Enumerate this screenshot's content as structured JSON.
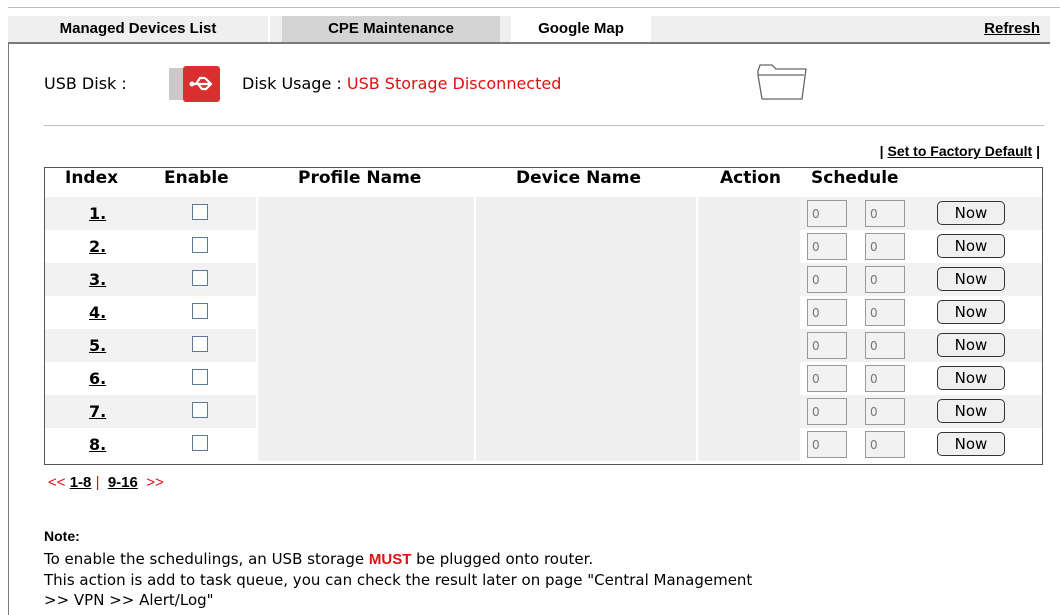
{
  "tabs": [
    {
      "label": "Managed Devices List"
    },
    {
      "label": "CPE Maintenance"
    },
    {
      "label": "Google Map"
    }
  ],
  "refresh_label": "Refresh",
  "usb": {
    "label": "USB Disk :",
    "usage_label": "Disk Usage :",
    "usage_status": "USB Storage Disconnected",
    "icon": "usb-icon",
    "folder_icon": "folder-icon"
  },
  "factory_default": "Set to Factory Default",
  "table": {
    "headers": [
      "Index",
      "Enable",
      "Profile Name",
      "Device Name",
      "Action",
      "Schedule"
    ],
    "rows": [
      {
        "index": "1.",
        "enabled": false,
        "profile": "",
        "device": "",
        "action": "",
        "sched_a": "0",
        "sched_b": "0",
        "button": "Now"
      },
      {
        "index": "2.",
        "enabled": false,
        "profile": "",
        "device": "",
        "action": "",
        "sched_a": "0",
        "sched_b": "0",
        "button": "Now"
      },
      {
        "index": "3.",
        "enabled": false,
        "profile": "",
        "device": "",
        "action": "",
        "sched_a": "0",
        "sched_b": "0",
        "button": "Now"
      },
      {
        "index": "4.",
        "enabled": false,
        "profile": "",
        "device": "",
        "action": "",
        "sched_a": "0",
        "sched_b": "0",
        "button": "Now"
      },
      {
        "index": "5.",
        "enabled": false,
        "profile": "",
        "device": "",
        "action": "",
        "sched_a": "0",
        "sched_b": "0",
        "button": "Now"
      },
      {
        "index": "6.",
        "enabled": false,
        "profile": "",
        "device": "",
        "action": "",
        "sched_a": "0",
        "sched_b": "0",
        "button": "Now"
      },
      {
        "index": "7.",
        "enabled": false,
        "profile": "",
        "device": "",
        "action": "",
        "sched_a": "0",
        "sched_b": "0",
        "button": "Now"
      },
      {
        "index": "8.",
        "enabled": false,
        "profile": "",
        "device": "",
        "action": "",
        "sched_a": "0",
        "sched_b": "0",
        "button": "Now"
      }
    ]
  },
  "pager": {
    "prev": "<<",
    "page1": "1-8",
    "separator": "|",
    "page2": "9-16",
    "next": ">>"
  },
  "note": {
    "title": "Note:",
    "line1_before": "To enable the schedulings, an USB storage",
    "line1_must": "MUST",
    "line1_after": "be plugged onto router.",
    "line2": "This action is add to task queue, you can check the result later on page \"Central Management",
    "line3": ">> VPN >> Alert/Log\""
  },
  "colors": {
    "accent_red": "#e01010",
    "tab_bg": "#efefef",
    "active_tab_bg": "#d4d4d4",
    "row_shade": "#f2f2f2"
  }
}
